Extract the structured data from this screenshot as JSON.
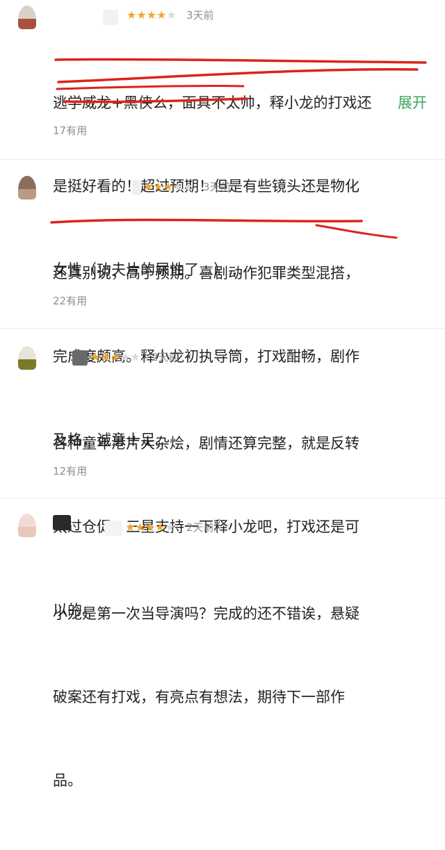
{
  "reviews": [
    {
      "rating": 4,
      "date": "3天前",
      "lines": [
        "逃学威龙+黑侠么，面具不太帅，释小龙的打戏还",
        "是挺好看的！超过预期！但是有些镜头还是物化",
        "女性（功夫片的尿性了…）..."
      ],
      "expand_label": "展开",
      "useful": "17有用",
      "avatar_colors": [
        "#d9d0c8",
        "#a8523d"
      ]
    },
    {
      "rating": 3,
      "date": "3天前",
      "lines": [
        "还真别说，高于预期。喜剧动作犯罪类型混搭，",
        "完成度颇高。释小龙初执导筒，打戏酣畅，剧作",
        "及格，诚意十足。"
      ],
      "useful": "22有用",
      "avatar_colors": [
        "#8a6e5a",
        "#b99a86"
      ]
    },
    {
      "rating": 3,
      "date": "2天前",
      "lines": [
        "各种童年港片大杂烩，剧情还算完整，就是反转",
        "太过仓促，三星支持一下释小龙吧，打戏还是可",
        "以的。"
      ],
      "useful": "12有用",
      "avatar_colors": [
        "#e8e4d8",
        "#7a7a2a"
      ]
    },
    {
      "rating": 4,
      "date": "2天前",
      "lines": [
        "小龙是第一次当导演吗？完成的还不错诶，悬疑",
        "破案还有打戏，有亮点有想法，期待下一部作",
        "品。"
      ],
      "avatar_colors": [
        "#f0dcd4",
        "#e8c8bc"
      ]
    }
  ],
  "colors": {
    "star_on": "#f4a623",
    "star_off": "#d9d9d9",
    "expand_green": "#3ba55d",
    "underline_red": "#d9251c"
  }
}
